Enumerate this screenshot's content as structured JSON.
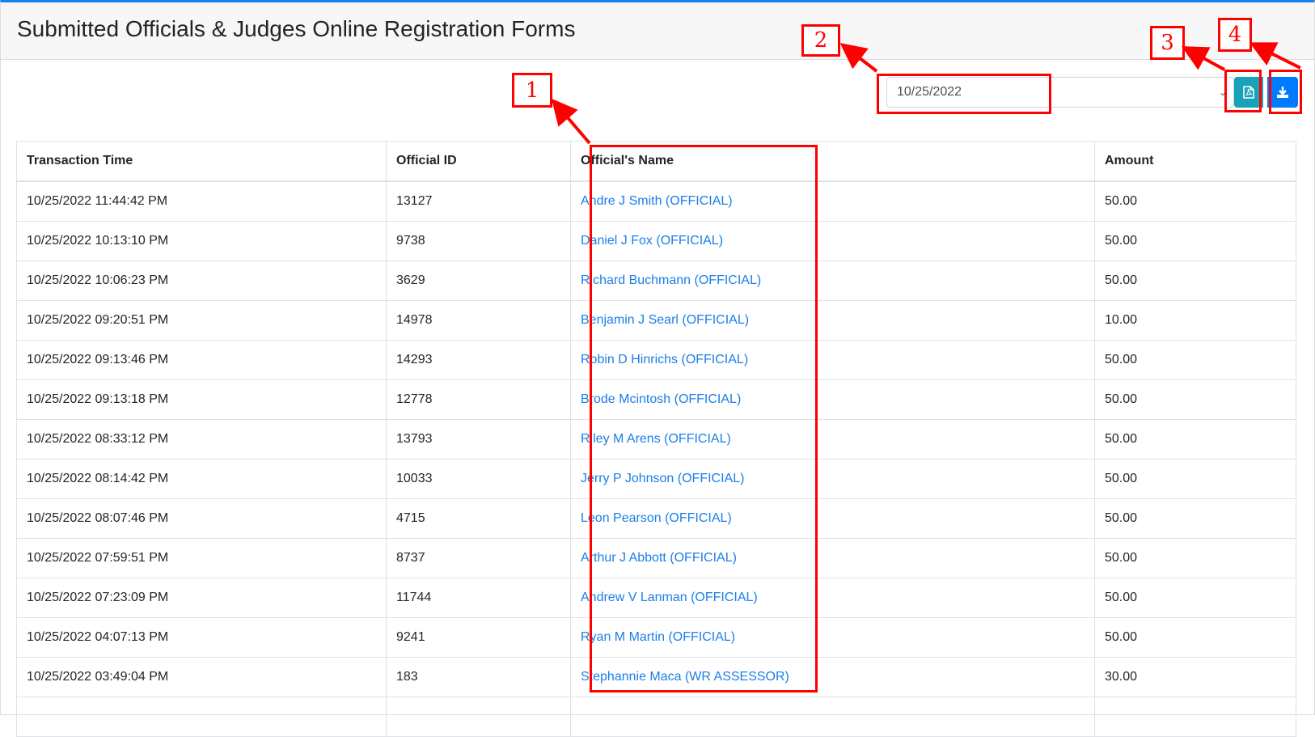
{
  "page": {
    "title": "Submitted Officials & Judges Online Registration Forms"
  },
  "filter": {
    "date": "10/25/2022"
  },
  "toolbar": {
    "pdf_icon": "file-pdf-icon",
    "download_icon": "download-icon"
  },
  "table": {
    "headers": [
      "Transaction Time",
      "Official ID",
      "Official's Name",
      "Amount"
    ],
    "rows": [
      {
        "time": "10/25/2022 11:44:42 PM",
        "id": "13127",
        "name": "Andre J Smith (OFFICIAL)",
        "amount": "50.00"
      },
      {
        "time": "10/25/2022 10:13:10 PM",
        "id": "9738",
        "name": "Daniel J Fox (OFFICIAL)",
        "amount": "50.00"
      },
      {
        "time": "10/25/2022 10:06:23 PM",
        "id": "3629",
        "name": "Richard Buchmann (OFFICIAL)",
        "amount": "50.00"
      },
      {
        "time": "10/25/2022 09:20:51 PM",
        "id": "14978",
        "name": "Benjamin J Searl (OFFICIAL)",
        "amount": "10.00"
      },
      {
        "time": "10/25/2022 09:13:46 PM",
        "id": "14293",
        "name": "Robin D Hinrichs (OFFICIAL)",
        "amount": "50.00"
      },
      {
        "time": "10/25/2022 09:13:18 PM",
        "id": "12778",
        "name": "Brode Mcintosh (OFFICIAL)",
        "amount": "50.00"
      },
      {
        "time": "10/25/2022 08:33:12 PM",
        "id": "13793",
        "name": "Riley M Arens (OFFICIAL)",
        "amount": "50.00"
      },
      {
        "time": "10/25/2022 08:14:42 PM",
        "id": "10033",
        "name": "Jerry P Johnson (OFFICIAL)",
        "amount": "50.00"
      },
      {
        "time": "10/25/2022 08:07:46 PM",
        "id": "4715",
        "name": "Leon Pearson (OFFICIAL)",
        "amount": "50.00"
      },
      {
        "time": "10/25/2022 07:59:51 PM",
        "id": "8737",
        "name": "Arthur J Abbott (OFFICIAL)",
        "amount": "50.00"
      },
      {
        "time": "10/25/2022 07:23:09 PM",
        "id": "11744",
        "name": "Andrew V Lanman (OFFICIAL)",
        "amount": "50.00"
      },
      {
        "time": "10/25/2022 04:07:13 PM",
        "id": "9241",
        "name": "Ryan M Martin (OFFICIAL)",
        "amount": "50.00"
      },
      {
        "time": "10/25/2022 03:49:04 PM",
        "id": "183",
        "name": "Stephannie Maca (WR ASSESSOR)",
        "amount": "30.00"
      },
      {
        "time": "",
        "id": "",
        "name": "",
        "amount": ""
      }
    ]
  },
  "annotations": {
    "labels": [
      "1",
      "2",
      "3",
      "4"
    ],
    "color": "#ff0000"
  },
  "colors": {
    "accent": "#1a7fe8",
    "pdf_button": "#17a2b8",
    "download_button": "#007bff"
  }
}
